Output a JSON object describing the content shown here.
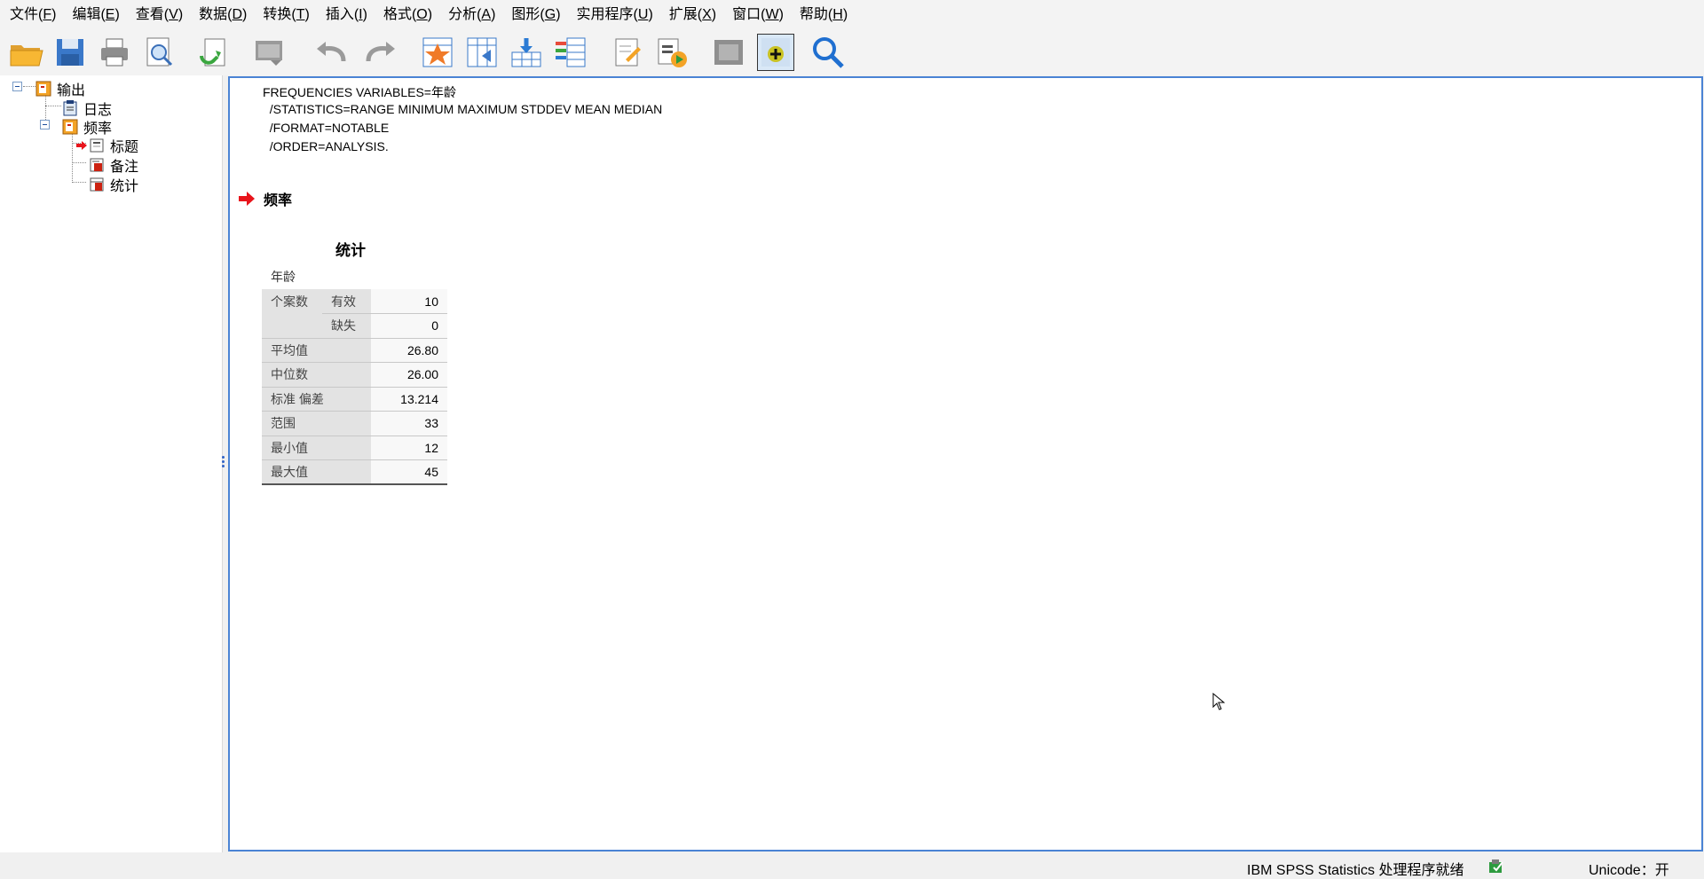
{
  "menu": [
    {
      "label": "文件(",
      "key": "F",
      "tail": ")"
    },
    {
      "label": "编辑(",
      "key": "E",
      "tail": ")"
    },
    {
      "label": "查看(",
      "key": "V",
      "tail": ")"
    },
    {
      "label": "数据(",
      "key": "D",
      "tail": ")"
    },
    {
      "label": "转换(",
      "key": "T",
      "tail": ")"
    },
    {
      "label": "插入(",
      "key": "I",
      "tail": ")"
    },
    {
      "label": "格式(",
      "key": "O",
      "tail": ")"
    },
    {
      "label": "分析(",
      "key": "A",
      "tail": ")"
    },
    {
      "label": "图形(",
      "key": "G",
      "tail": ")"
    },
    {
      "label": "实用程序(",
      "key": "U",
      "tail": ")"
    },
    {
      "label": "扩展(",
      "key": "X",
      "tail": ")"
    },
    {
      "label": "窗口(",
      "key": "W",
      "tail": ")"
    },
    {
      "label": "帮助(",
      "key": "H",
      "tail": ")"
    }
  ],
  "toolbar_icons": [
    "open-folder-icon",
    "save-icon",
    "print-icon",
    "print-preview-icon",
    "export-icon",
    "recall-dialog-icon",
    "undo-icon",
    "redo-icon",
    "goto-case-icon",
    "goto-variable-icon",
    "insert-cases-icon",
    "insert-variables-icon",
    "designate-window-icon",
    "run-script-icon",
    "hide-icon",
    "insert-new-icon",
    "search-icon"
  ],
  "tree": {
    "root": "输出",
    "log": "日志",
    "frequencies": "频率",
    "title": "标题",
    "notes": "备注",
    "statistics": "统计"
  },
  "syntax": {
    "line1": "FREQUENCIES VARIABLES=年龄",
    "line2": "  /STATISTICS=RANGE MINIMUM MAXIMUM STDDEV MEAN MEDIAN",
    "line3": "  /FORMAT=NOTABLE",
    "line4": "  /ORDER=ANALYSIS."
  },
  "output": {
    "heading": "频率",
    "table_title": "统计",
    "variable": "年龄",
    "rows": {
      "n_label": "个案数",
      "valid_label": "有效",
      "valid_value": "10",
      "missing_label": "缺失",
      "missing_value": "0",
      "mean_label": "平均值",
      "mean_value": "26.80",
      "median_label": "中位数",
      "median_value": "26.00",
      "std_label": "标准 偏差",
      "std_value": "13.214",
      "range_label": "范围",
      "range_value": "33",
      "min_label": "最小值",
      "min_value": "12",
      "max_label": "最大值",
      "max_value": "45"
    }
  },
  "status": {
    "text": "IBM SPSS Statistics 处理程序就绪",
    "unicode": "Unicode：开"
  },
  "colors": {
    "accent_border": "#4a83d4",
    "arrow_red": "#e8141b"
  }
}
